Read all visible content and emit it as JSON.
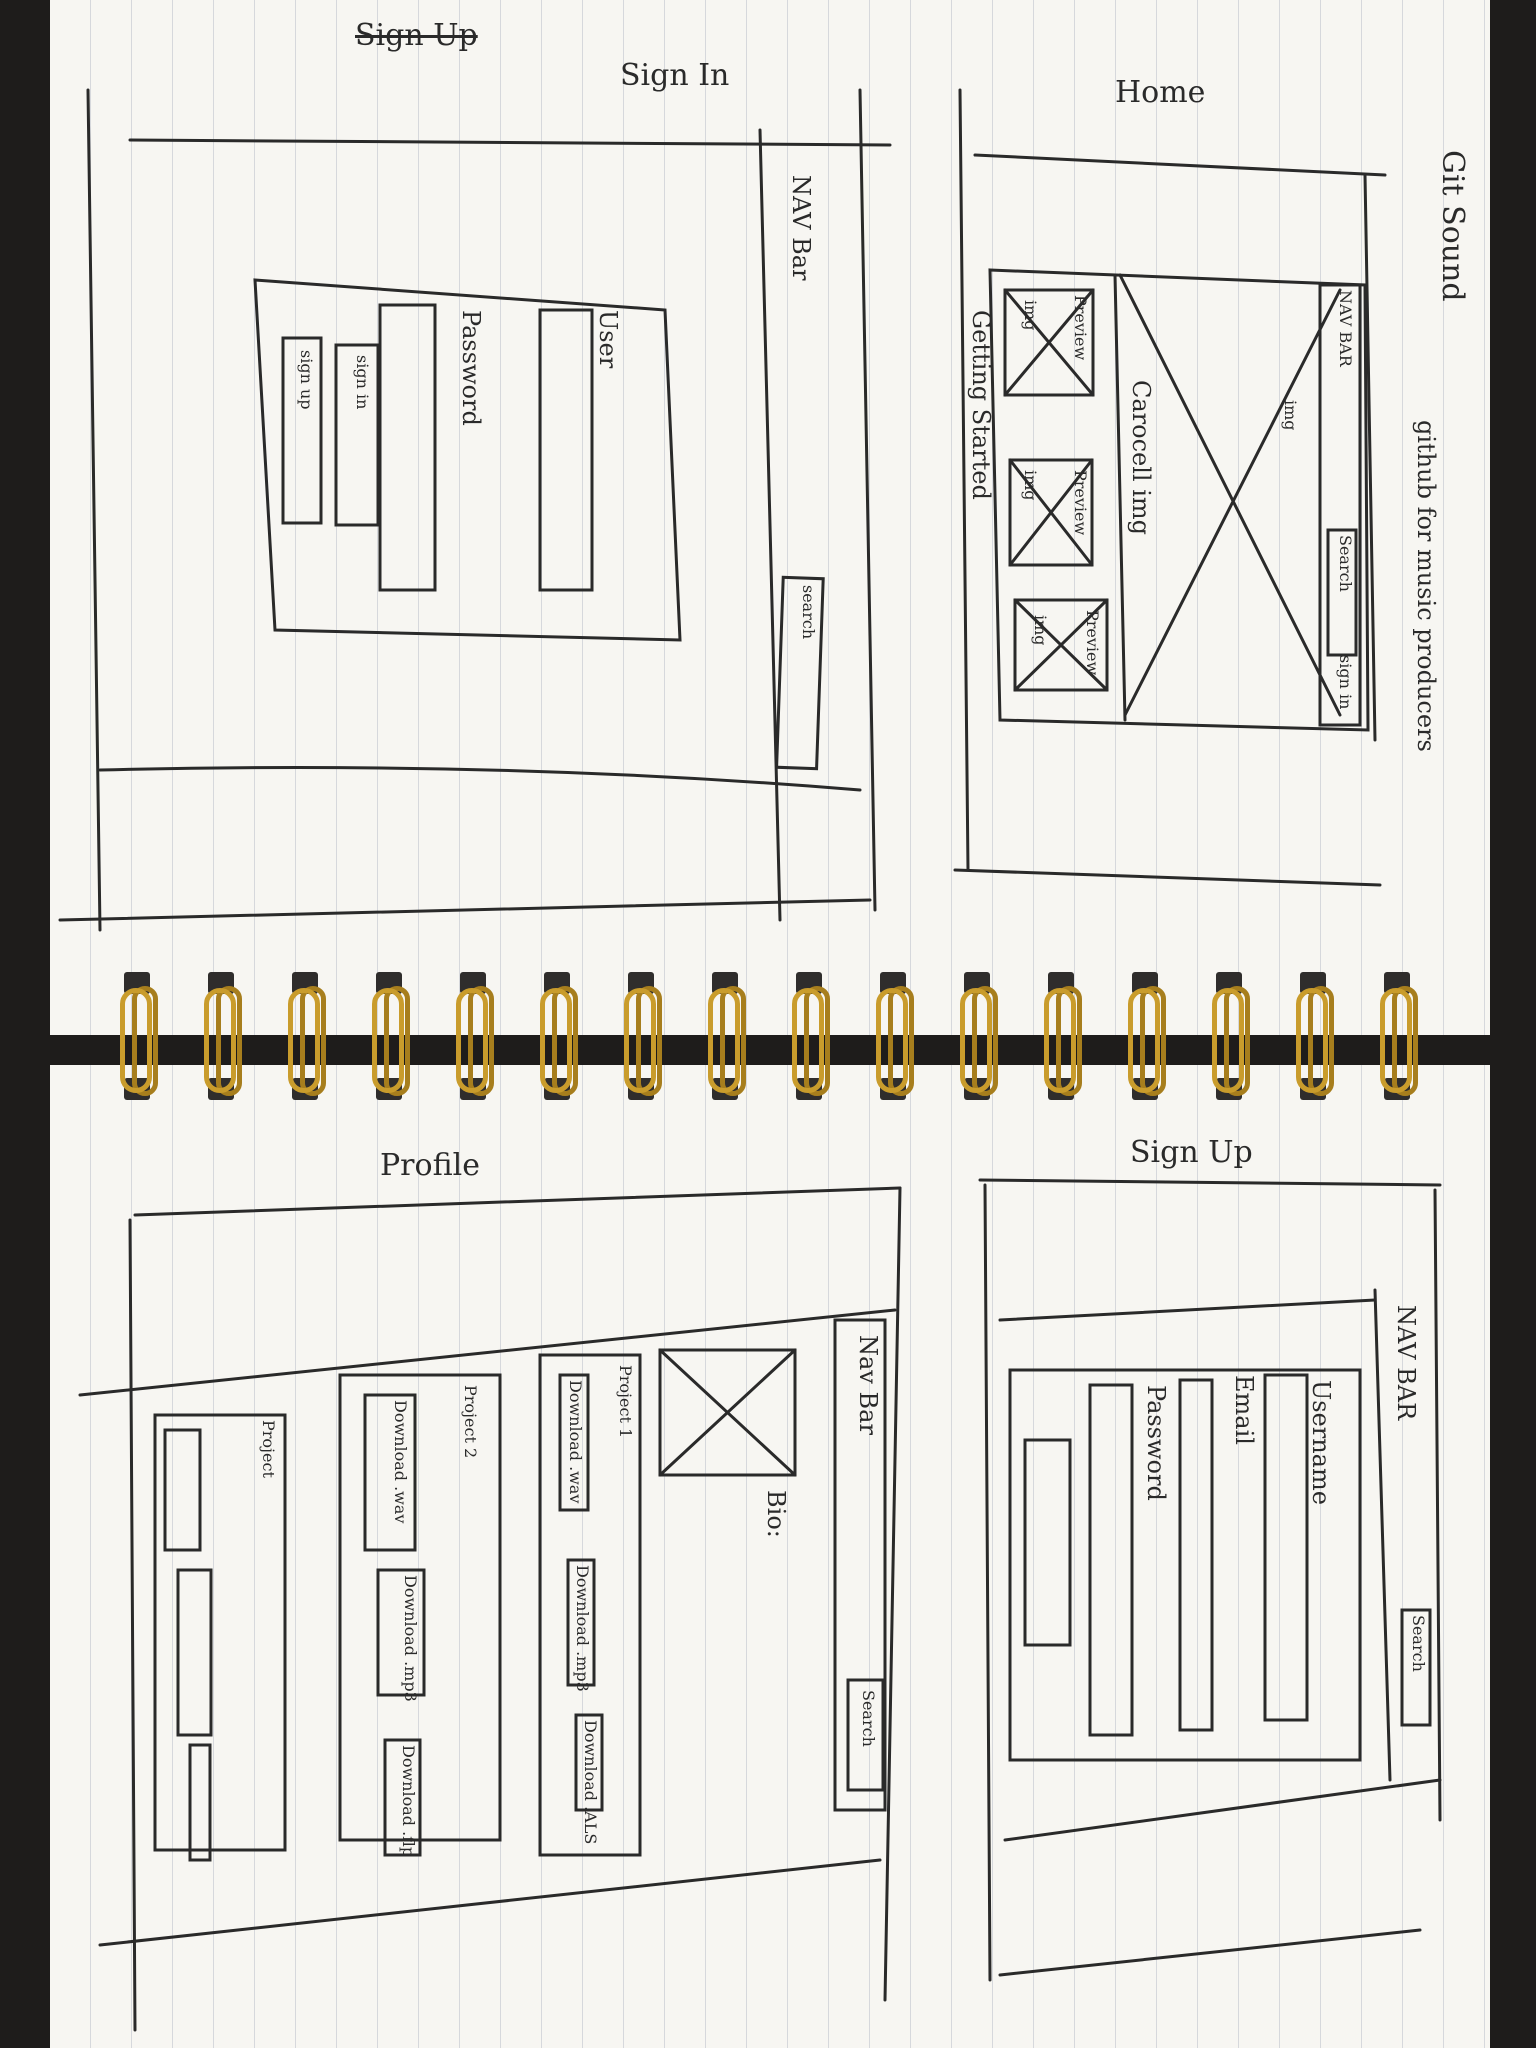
{
  "notebook": {
    "top_left": {
      "title": "Sign In",
      "struck_title": "Sign Up",
      "navbar_label": "NAV Bar",
      "search_button": "search",
      "user_label": "User",
      "password_label": "Password",
      "signin_button": "sign in",
      "signup_button": "sign up"
    },
    "top_right": {
      "title": "Home",
      "brand": "Git Sound",
      "tagline": "github for music producers",
      "navbar_label": "NAV BAR",
      "img_label": "img",
      "search_button": "Search",
      "signin_button": "sign in",
      "carousel_label": "Carocell img",
      "getting_started": "Getting Started",
      "cards": [
        {
          "img": "img",
          "label": "Preview"
        },
        {
          "img": "img",
          "label": "Preview"
        },
        {
          "img": "img",
          "label": "Preview"
        }
      ]
    },
    "bottom_left": {
      "title": "Profile",
      "navbar_label": "Nav Bar",
      "search_button": "Search",
      "bio_label": "Bio:",
      "projects": [
        {
          "label": "Project 1",
          "buttons": [
            "Download .wav",
            "Download .mp3",
            "Download .ALS"
          ]
        },
        {
          "label": "Project 2",
          "buttons": [
            "Download .wav",
            "Download .mp3",
            "Download .flp"
          ]
        },
        {
          "label": "Project",
          "buttons": []
        }
      ]
    },
    "bottom_right": {
      "title": "Sign Up",
      "navbar_label": "NAV BAR",
      "search_button": "Search",
      "username_label": "Username",
      "email_label": "Email",
      "password_label": "Password"
    }
  },
  "colors": {
    "paper": "#f7f6f2",
    "ink": "#2a2a2a",
    "ring_gold": "#c99c2c",
    "background": "#1e1c1b"
  }
}
